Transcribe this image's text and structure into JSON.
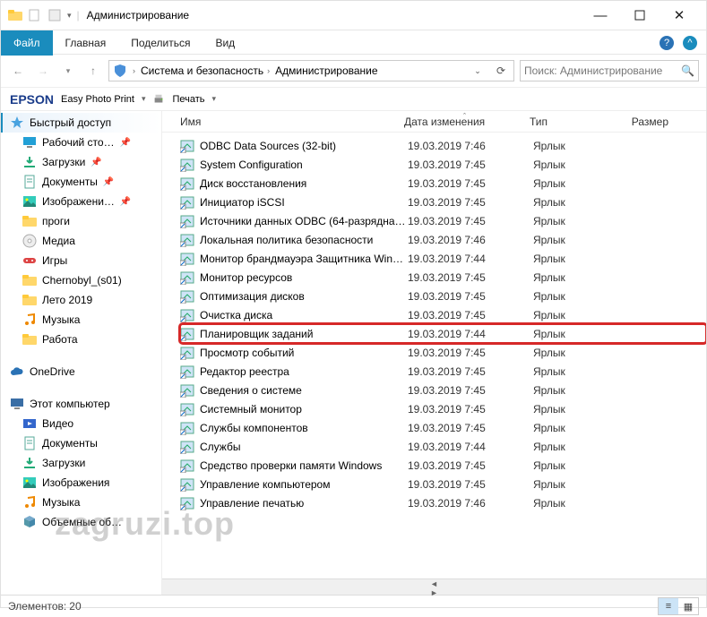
{
  "title": "Администрирование",
  "ribbon": {
    "file": "Файл",
    "home": "Главная",
    "share": "Поделиться",
    "view": "Вид"
  },
  "breadcrumb": [
    "Система и безопасность",
    "Администрирование"
  ],
  "search": {
    "placeholder": "Поиск: Администрирование"
  },
  "toolbar": {
    "epson": "EPSON",
    "epp": "Easy Photo Print",
    "print": "Печать"
  },
  "columns": {
    "name": "Имя",
    "date": "Дата изменения",
    "type": "Тип",
    "size": "Размер"
  },
  "sidebar": [
    {
      "kind": "section",
      "label": "Быстрый доступ",
      "icon": "star"
    },
    {
      "kind": "item",
      "label": "Рабочий сто…",
      "icon": "desktop",
      "pin": true
    },
    {
      "kind": "item",
      "label": "Загрузки",
      "icon": "downloads",
      "pin": true
    },
    {
      "kind": "item",
      "label": "Документы",
      "icon": "doc",
      "pin": true
    },
    {
      "kind": "item",
      "label": "Изображени…",
      "icon": "pic",
      "pin": true
    },
    {
      "kind": "item",
      "label": "проги",
      "icon": "folder"
    },
    {
      "kind": "item",
      "label": "Медиа",
      "icon": "disc"
    },
    {
      "kind": "item",
      "label": "Игры",
      "icon": "games"
    },
    {
      "kind": "item",
      "label": "Chernobyl_(s01)",
      "icon": "folder"
    },
    {
      "kind": "item",
      "label": "Лето 2019",
      "icon": "folder"
    },
    {
      "kind": "item",
      "label": "Музыка",
      "icon": "music"
    },
    {
      "kind": "item",
      "label": "Работа",
      "icon": "folder"
    },
    {
      "kind": "sep"
    },
    {
      "kind": "section",
      "label": "OneDrive",
      "icon": "cloud"
    },
    {
      "kind": "sep"
    },
    {
      "kind": "section",
      "label": "Этот компьютер",
      "icon": "pc"
    },
    {
      "kind": "item",
      "label": "Видео",
      "icon": "video"
    },
    {
      "kind": "item",
      "label": "Документы",
      "icon": "doc"
    },
    {
      "kind": "item",
      "label": "Загрузки",
      "icon": "downloads"
    },
    {
      "kind": "item",
      "label": "Изображения",
      "icon": "pic"
    },
    {
      "kind": "item",
      "label": "Музыка",
      "icon": "music"
    },
    {
      "kind": "item",
      "label": "Объемные об…",
      "icon": "cube"
    }
  ],
  "rows": [
    {
      "name": "ODBC Data Sources (32-bit)",
      "date": "19.03.2019 7:46",
      "type": "Ярлык"
    },
    {
      "name": "System Configuration",
      "date": "19.03.2019 7:45",
      "type": "Ярлык"
    },
    {
      "name": "Диск восстановления",
      "date": "19.03.2019 7:45",
      "type": "Ярлык"
    },
    {
      "name": "Инициатор iSCSI",
      "date": "19.03.2019 7:45",
      "type": "Ярлык"
    },
    {
      "name": "Источники данных ODBC (64-разрядна…",
      "date": "19.03.2019 7:45",
      "type": "Ярлык"
    },
    {
      "name": "Локальная политика безопасности",
      "date": "19.03.2019 7:46",
      "type": "Ярлык"
    },
    {
      "name": "Монитор брандмауэра Защитника Win…",
      "date": "19.03.2019 7:44",
      "type": "Ярлык"
    },
    {
      "name": "Монитор ресурсов",
      "date": "19.03.2019 7:45",
      "type": "Ярлык"
    },
    {
      "name": "Оптимизация дисков",
      "date": "19.03.2019 7:45",
      "type": "Ярлык"
    },
    {
      "name": "Очистка диска",
      "date": "19.03.2019 7:45",
      "type": "Ярлык"
    },
    {
      "name": "Планировщик заданий",
      "date": "19.03.2019 7:44",
      "type": "Ярлык",
      "highlight": true
    },
    {
      "name": "Просмотр событий",
      "date": "19.03.2019 7:45",
      "type": "Ярлык"
    },
    {
      "name": "Редактор реестра",
      "date": "19.03.2019 7:45",
      "type": "Ярлык"
    },
    {
      "name": "Сведения о системе",
      "date": "19.03.2019 7:45",
      "type": "Ярлык"
    },
    {
      "name": "Системный монитор",
      "date": "19.03.2019 7:45",
      "type": "Ярлык"
    },
    {
      "name": "Службы компонентов",
      "date": "19.03.2019 7:45",
      "type": "Ярлык"
    },
    {
      "name": "Службы",
      "date": "19.03.2019 7:44",
      "type": "Ярлык"
    },
    {
      "name": "Средство проверки памяти Windows",
      "date": "19.03.2019 7:45",
      "type": "Ярлык"
    },
    {
      "name": "Управление компьютером",
      "date": "19.03.2019 7:45",
      "type": "Ярлык"
    },
    {
      "name": "Управление печатью",
      "date": "19.03.2019 7:46",
      "type": "Ярлык"
    }
  ],
  "status": {
    "label": "Элементов:",
    "count": "20"
  },
  "watermark": "zagruzi.top"
}
